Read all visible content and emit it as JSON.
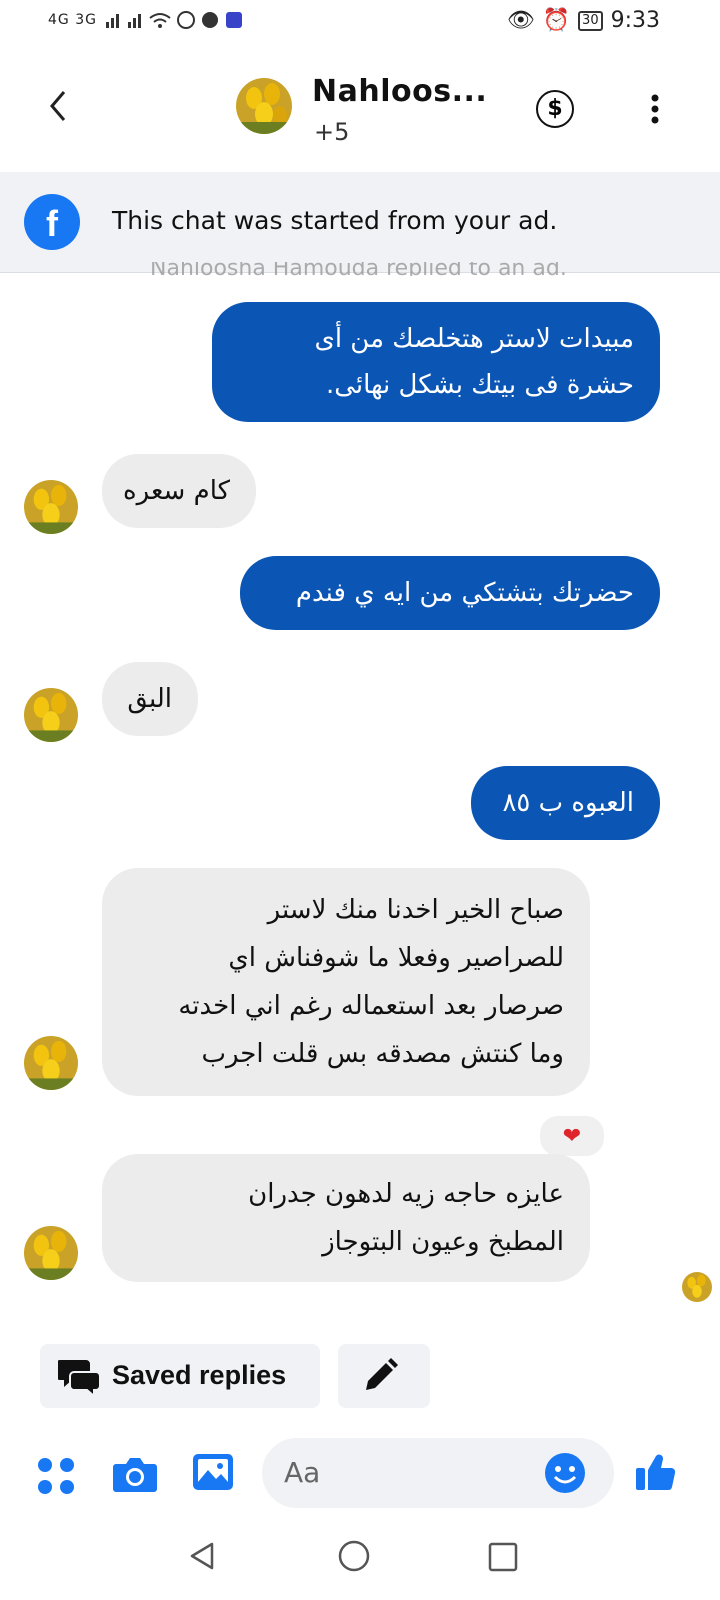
{
  "status_bar": {
    "left_indicators": "4G 3G",
    "time": "9:33",
    "battery": "30"
  },
  "header": {
    "title": "Nahloos...",
    "subtitle": "+5"
  },
  "banner": {
    "text": "This chat was started from your ad.",
    "ghost_text": "Nahloosha Hamouda replied to an ad."
  },
  "messages": [
    {
      "dir": "out",
      "lines": [
        "مبيدات لاستر هتخلصك من أى",
        "حشرة فى بيتك بشكل نهائى."
      ]
    },
    {
      "dir": "in",
      "lines": [
        "كام سعره"
      ]
    },
    {
      "dir": "out",
      "lines": [
        "حضرتك بتشتكي من ايه ي فندم"
      ]
    },
    {
      "dir": "in",
      "lines": [
        "البق"
      ]
    },
    {
      "dir": "out",
      "lines": [
        "العبوه ب ٨٥"
      ]
    },
    {
      "dir": "in",
      "lines": [
        "صباح الخير اخدنا منك لاستر",
        "للصراصير وفعلا ما شوفناش اي",
        "صرصار بعد استعماله رغم اني اخدته",
        "وما كنتش مصدقه بس قلت اجرب"
      ],
      "reaction": "❤"
    },
    {
      "dir": "in",
      "lines": [
        "عايزه حاجه زيه لدهون جدران",
        "المطبخ وعيون البتوجاز"
      ]
    }
  ],
  "quick_actions": {
    "saved_replies_label": "Saved replies"
  },
  "composer": {
    "placeholder": "Aa"
  },
  "colors": {
    "outgoing_bubble": "#0b55b5",
    "incoming_bubble": "#ececec",
    "accent": "#1877f2"
  }
}
